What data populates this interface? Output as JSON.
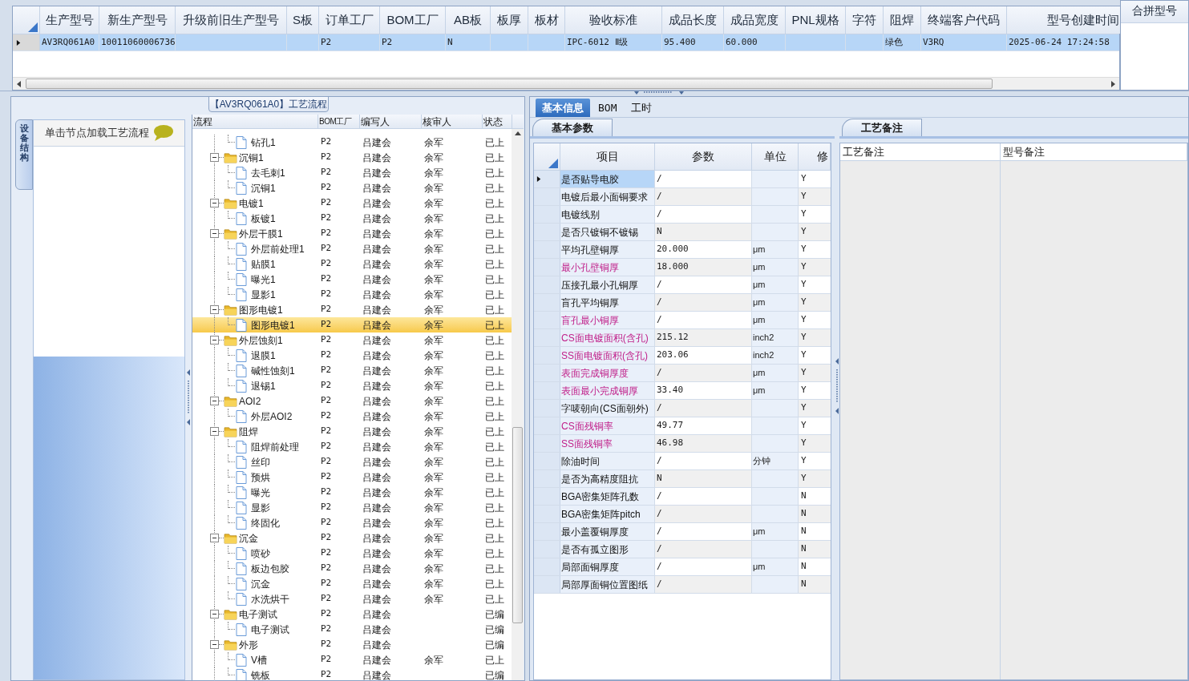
{
  "top_grid": {
    "columns": [
      "生产型号",
      "新生产型号",
      "升级前旧生产型号",
      "S板",
      "订单工厂",
      "BOM工厂",
      "AB板",
      "板厚",
      "板材",
      "验收标准",
      "成品长度",
      "成品宽度",
      "PNL规格",
      "字符",
      "阻焊",
      "终端客户代码",
      "型号创建时间"
    ],
    "rows": [
      {
        "selected": true,
        "cells": [
          "AV3RQ061A0",
          "10011060006736",
          null,
          null,
          "P2",
          "P2",
          "N",
          null,
          null,
          "IPC-6012 Ⅱ级",
          "95.400",
          "60.000",
          null,
          null,
          "绿色",
          "V3RQ",
          "2025-06-24 17:24:58"
        ]
      }
    ]
  },
  "merge_panel": {
    "header": "合拼型号"
  },
  "process_panel": {
    "title": "【AV3RQ061A0】工艺流程",
    "side_tab": "设备结构",
    "hint": "单击节点加载工艺流程",
    "tree": {
      "columns": [
        "流程",
        "BOM工厂",
        "编写人",
        "核审人",
        "状态"
      ],
      "rows": [
        {
          "kind": "file",
          "name": "钻孔1",
          "bom": "P2",
          "writer": "吕建会",
          "reviewer": "余军",
          "status": "已上",
          "selected": false
        },
        {
          "kind": "folder",
          "name": "沉铜1",
          "bom": "P2",
          "writer": "吕建会",
          "reviewer": "余军",
          "status": "已上",
          "selected": false,
          "expanded": true,
          "children": [
            {
              "kind": "file",
              "name": "去毛刺1",
              "bom": "P2",
              "writer": "吕建会",
              "reviewer": "余军",
              "status": "已上",
              "selected": false
            },
            {
              "kind": "file",
              "name": "沉铜1",
              "bom": "P2",
              "writer": "吕建会",
              "reviewer": "余军",
              "status": "已上",
              "selected": false
            }
          ]
        },
        {
          "kind": "folder",
          "name": "电镀1",
          "bom": "P2",
          "writer": "吕建会",
          "reviewer": "余军",
          "status": "已上",
          "selected": false,
          "expanded": true,
          "children": [
            {
              "kind": "file",
              "name": "板镀1",
              "bom": "P2",
              "writer": "吕建会",
              "reviewer": "余军",
              "status": "已上",
              "selected": false
            }
          ]
        },
        {
          "kind": "folder",
          "name": "外层干膜1",
          "bom": "P2",
          "writer": "吕建会",
          "reviewer": "余军",
          "status": "已上",
          "selected": false,
          "expanded": true,
          "children": [
            {
              "kind": "file",
              "name": "外层前处理1",
              "bom": "P2",
              "writer": "吕建会",
              "reviewer": "余军",
              "status": "已上",
              "selected": false
            },
            {
              "kind": "file",
              "name": "贴膜1",
              "bom": "P2",
              "writer": "吕建会",
              "reviewer": "余军",
              "status": "已上",
              "selected": false
            },
            {
              "kind": "file",
              "name": "曝光1",
              "bom": "P2",
              "writer": "吕建会",
              "reviewer": "余军",
              "status": "已上",
              "selected": false
            },
            {
              "kind": "file",
              "name": "显影1",
              "bom": "P2",
              "writer": "吕建会",
              "reviewer": "余军",
              "status": "已上",
              "selected": false
            }
          ]
        },
        {
          "kind": "folder",
          "name": "图形电镀1",
          "bom": "P2",
          "writer": "吕建会",
          "reviewer": "余军",
          "status": "已上",
          "selected": false,
          "expanded": true,
          "children": [
            {
              "kind": "file",
              "name": "图形电镀1",
              "bom": "P2",
              "writer": "吕建会",
              "reviewer": "余军",
              "status": "已上",
              "selected": true
            }
          ]
        },
        {
          "kind": "folder",
          "name": "外层蚀刻1",
          "bom": "P2",
          "writer": "吕建会",
          "reviewer": "余军",
          "status": "已上",
          "selected": false,
          "expanded": true,
          "children": [
            {
              "kind": "file",
              "name": "退膜1",
              "bom": "P2",
              "writer": "吕建会",
              "reviewer": "余军",
              "status": "已上",
              "selected": false
            },
            {
              "kind": "file",
              "name": "碱性蚀刻1",
              "bom": "P2",
              "writer": "吕建会",
              "reviewer": "余军",
              "status": "已上",
              "selected": false
            },
            {
              "kind": "file",
              "name": "退锡1",
              "bom": "P2",
              "writer": "吕建会",
              "reviewer": "余军",
              "status": "已上",
              "selected": false
            }
          ]
        },
        {
          "kind": "folder",
          "name": "AOI2",
          "bom": "P2",
          "writer": "吕建会",
          "reviewer": "余军",
          "status": "已上",
          "selected": false,
          "expanded": true,
          "children": [
            {
              "kind": "file",
              "name": "外层AOI2",
              "bom": "P2",
              "writer": "吕建会",
              "reviewer": "余军",
              "status": "已上",
              "selected": false
            }
          ]
        },
        {
          "kind": "folder",
          "name": "阻焊",
          "bom": "P2",
          "writer": "吕建会",
          "reviewer": "余军",
          "status": "已上",
          "selected": false,
          "expanded": true,
          "children": [
            {
              "kind": "file",
              "name": "阻焊前处理",
              "bom": "P2",
              "writer": "吕建会",
              "reviewer": "余军",
              "status": "已上",
              "selected": false
            },
            {
              "kind": "file",
              "name": "丝印",
              "bom": "P2",
              "writer": "吕建会",
              "reviewer": "余军",
              "status": "已上",
              "selected": false
            },
            {
              "kind": "file",
              "name": "预烘",
              "bom": "P2",
              "writer": "吕建会",
              "reviewer": "余军",
              "status": "已上",
              "selected": false
            },
            {
              "kind": "file",
              "name": "曝光",
              "bom": "P2",
              "writer": "吕建会",
              "reviewer": "余军",
              "status": "已上",
              "selected": false
            },
            {
              "kind": "file",
              "name": "显影",
              "bom": "P2",
              "writer": "吕建会",
              "reviewer": "余军",
              "status": "已上",
              "selected": false
            },
            {
              "kind": "file",
              "name": "终固化",
              "bom": "P2",
              "writer": "吕建会",
              "reviewer": "余军",
              "status": "已上",
              "selected": false
            }
          ]
        },
        {
          "kind": "folder",
          "name": "沉金",
          "bom": "P2",
          "writer": "吕建会",
          "reviewer": "余军",
          "status": "已上",
          "selected": false,
          "expanded": true,
          "children": [
            {
              "kind": "file",
              "name": "喷砂",
              "bom": "P2",
              "writer": "吕建会",
              "reviewer": "余军",
              "status": "已上",
              "selected": false
            },
            {
              "kind": "file",
              "name": "板边包胶",
              "bom": "P2",
              "writer": "吕建会",
              "reviewer": "余军",
              "status": "已上",
              "selected": false
            },
            {
              "kind": "file",
              "name": "沉金",
              "bom": "P2",
              "writer": "吕建会",
              "reviewer": "余军",
              "status": "已上",
              "selected": false
            },
            {
              "kind": "file",
              "name": "水洗烘干",
              "bom": "P2",
              "writer": "吕建会",
              "reviewer": "余军",
              "status": "已上",
              "selected": false
            }
          ]
        },
        {
          "kind": "folder",
          "name": "电子测试",
          "bom": "P2",
          "writer": "吕建会",
          "status": "已编",
          "selected": false,
          "expanded": true,
          "children": [
            {
              "kind": "file",
              "name": "电子测试",
              "bom": "P2",
              "writer": "吕建会",
              "status": "已编",
              "selected": false
            }
          ]
        },
        {
          "kind": "folder",
          "name": "外形",
          "bom": "P2",
          "writer": "吕建会",
          "status": "已编",
          "selected": false,
          "expanded": true,
          "children": [
            {
              "kind": "file",
              "name": "V槽",
              "bom": "P2",
              "writer": "吕建会",
              "reviewer": "余军",
              "status": "已上",
              "selected": false
            },
            {
              "kind": "file",
              "name": "铣板",
              "bom": "P2",
              "writer": "吕建会",
              "status": "已编",
              "selected": false
            }
          ]
        }
      ]
    }
  },
  "info_tabs": [
    {
      "label": "基本信息",
      "selected": true
    },
    {
      "label": "BOM",
      "selected": false
    },
    {
      "label": "工时",
      "selected": false
    }
  ],
  "params": {
    "tab": "基本参数",
    "columns": [
      "项目",
      "参数",
      "单位",
      "修"
    ],
    "rows": [
      {
        "item": "是否贴导电胶",
        "value": "/",
        "modified": "Y",
        "highlight": false,
        "selected": true
      },
      {
        "item": "电镀后最小面铜要求",
        "value": "/",
        "modified": "Y",
        "highlight": false,
        "selected": false
      },
      {
        "item": "电镀线别",
        "value": "/",
        "modified": "Y",
        "highlight": false,
        "selected": false
      },
      {
        "item": "是否只镀铜不镀锡",
        "value": "N",
        "modified": "Y",
        "highlight": false,
        "selected": false
      },
      {
        "item": "平均孔壁铜厚",
        "value": "20.000",
        "unit": "μm",
        "modified": "Y",
        "highlight": false,
        "selected": false
      },
      {
        "item": "最小孔壁铜厚",
        "value": "18.000",
        "unit": "μm",
        "modified": "Y",
        "highlight": true,
        "selected": false
      },
      {
        "item": "压接孔最小孔铜厚",
        "value": "/",
        "unit": "μm",
        "modified": "Y",
        "highlight": false,
        "selected": false
      },
      {
        "item": "盲孔平均铜厚",
        "value": "/",
        "unit": "μm",
        "modified": "Y",
        "highlight": false,
        "selected": false
      },
      {
        "item": "盲孔最小铜厚",
        "value": "/",
        "unit": "μm",
        "modified": "Y",
        "highlight": true,
        "selected": false
      },
      {
        "item": "CS面电镀面积(含孔)",
        "value": "215.12",
        "unit": "inch2",
        "modified": "Y",
        "highlight": true,
        "selected": false
      },
      {
        "item": "SS面电镀面积(含孔)",
        "value": "203.06",
        "unit": "inch2",
        "modified": "Y",
        "highlight": true,
        "selected": false
      },
      {
        "item": "表面完成铜厚度",
        "value": "/",
        "unit": "μm",
        "modified": "Y",
        "highlight": true,
        "selected": false
      },
      {
        "item": "表面最小完成铜厚",
        "value": "33.40",
        "unit": "μm",
        "modified": "Y",
        "highlight": true,
        "selected": false
      },
      {
        "item": "字唛朝向(CS面朝外)",
        "value": "/",
        "modified": "Y",
        "highlight": false,
        "selected": false
      },
      {
        "item": "CS面残铜率",
        "value": "49.77",
        "modified": "Y",
        "highlight": true,
        "selected": false
      },
      {
        "item": "SS面残铜率",
        "value": "46.98",
        "modified": "Y",
        "highlight": true,
        "selected": false
      },
      {
        "item": "除油时间",
        "value": "/",
        "unit": "分钟",
        "modified": "Y",
        "highlight": false,
        "selected": false
      },
      {
        "item": "是否为高精度阻抗",
        "value": "N",
        "modified": "Y",
        "highlight": false,
        "selected": false
      },
      {
        "item": "BGA密集矩阵孔数",
        "value": "/",
        "modified": "N",
        "highlight": false,
        "selected": false
      },
      {
        "item": "BGA密集矩阵pitch",
        "value": "/",
        "modified": "N",
        "highlight": false,
        "selected": false
      },
      {
        "item": "最小盖覆铜厚度",
        "value": "/",
        "unit": "μm",
        "modified": "N",
        "highlight": false,
        "selected": false
      },
      {
        "item": "是否有孤立图形",
        "value": "/",
        "modified": "N",
        "highlight": false,
        "selected": false
      },
      {
        "item": "局部面铜厚度",
        "value": "/",
        "unit": "μm",
        "modified": "N",
        "highlight": false,
        "selected": false
      },
      {
        "item": "局部厚面铜位置图纸",
        "value": "/",
        "modified": "N",
        "highlight": false,
        "selected": false
      }
    ]
  },
  "notes": {
    "tab": "工艺备注",
    "columns": [
      "工艺备注",
      "型号备注"
    ]
  }
}
